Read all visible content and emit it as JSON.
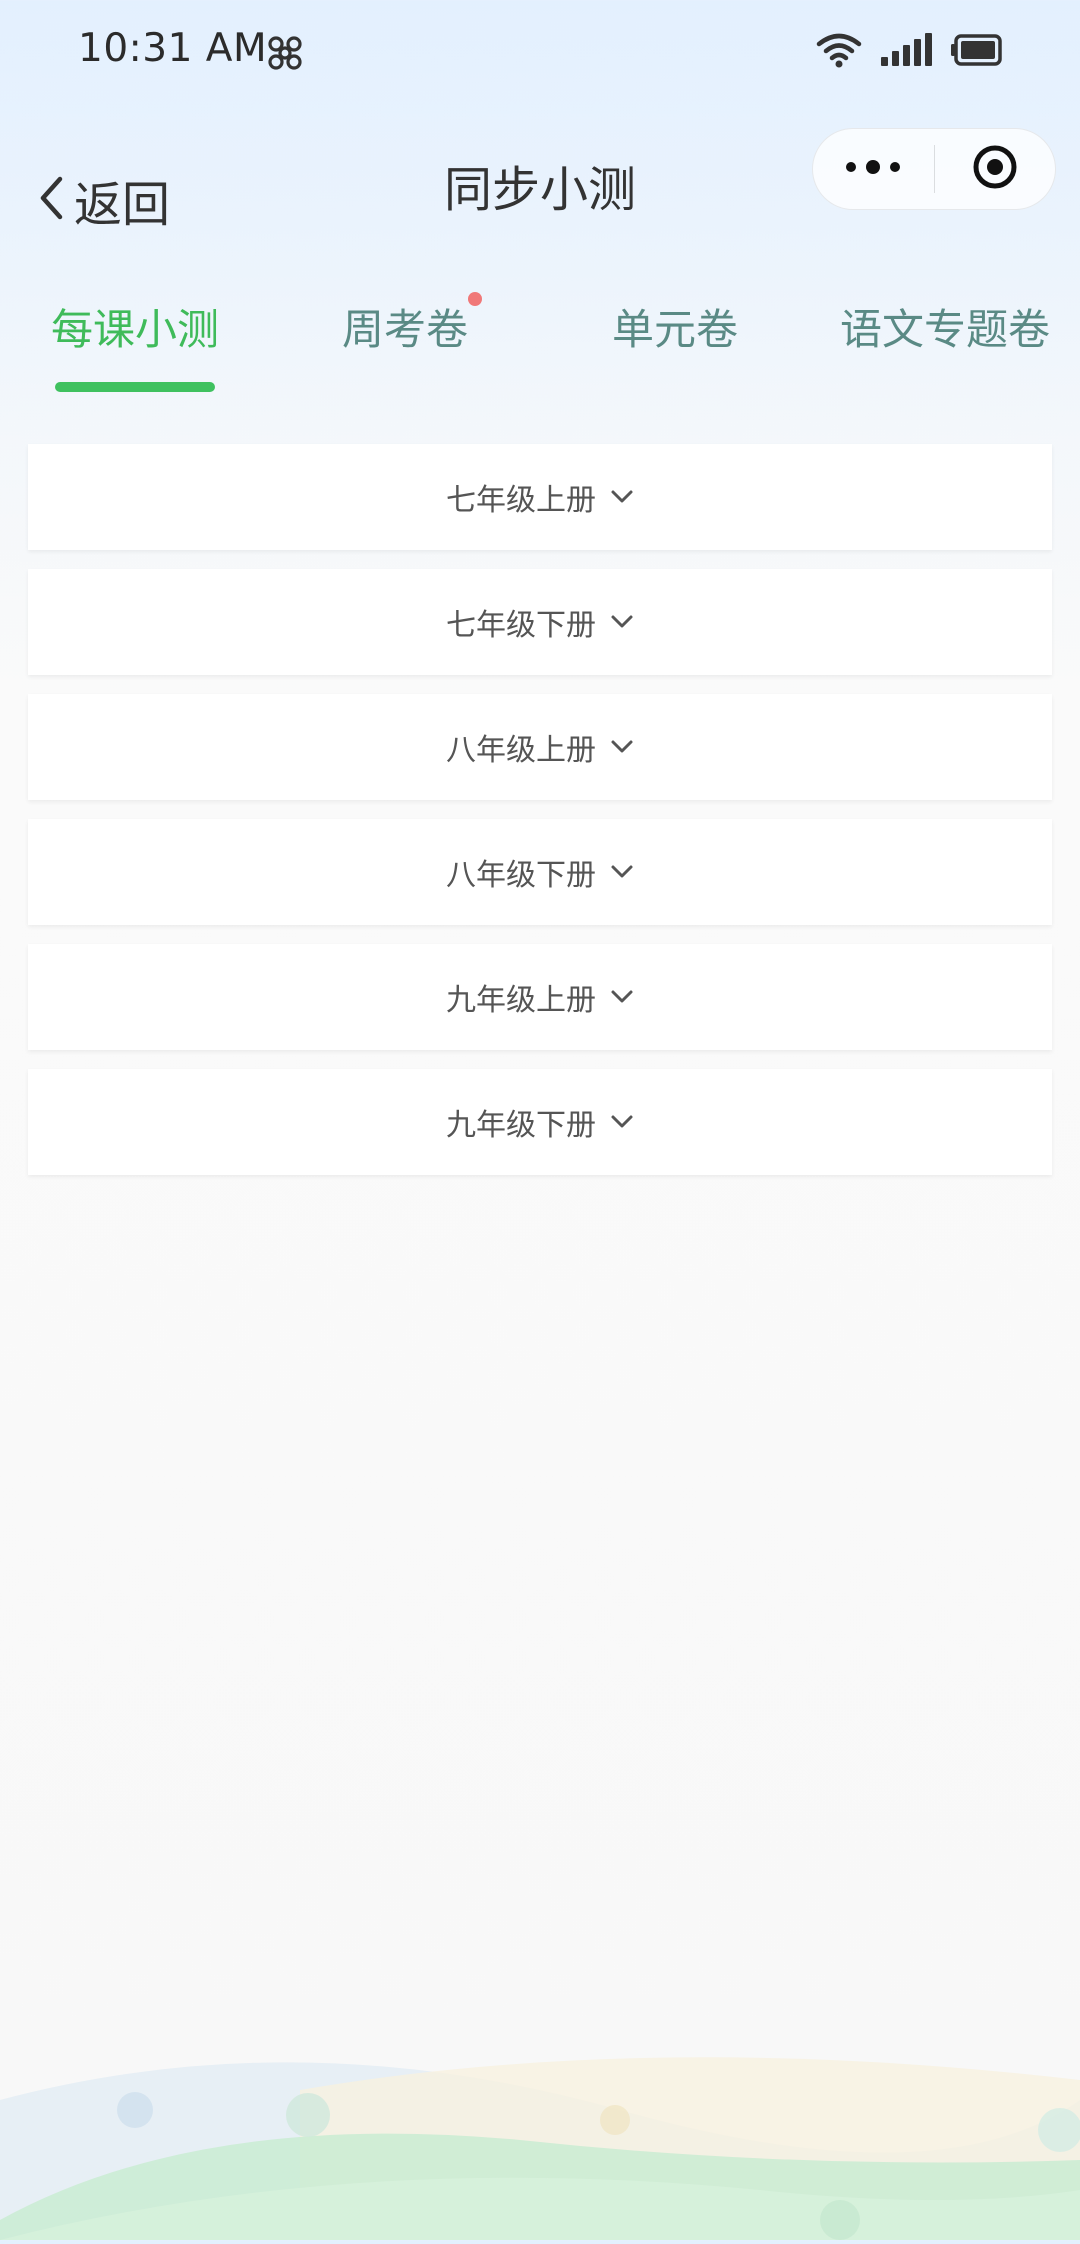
{
  "status_bar": {
    "time": "10:31 AM",
    "icons": [
      "china-unicom-logo-icon",
      "wifi-icon",
      "cellular-signal-icon",
      "battery-icon"
    ]
  },
  "nav": {
    "back_label": "返回",
    "title": "同步小测",
    "capsule_icons": [
      "more-dots-icon",
      "close-target-icon"
    ]
  },
  "tabs": [
    {
      "label": "每课小测",
      "active": true,
      "badge": false
    },
    {
      "label": "周考卷",
      "active": false,
      "badge": true
    },
    {
      "label": "单元卷",
      "active": false,
      "badge": false
    },
    {
      "label": "语文专题卷",
      "active": false,
      "badge": false
    }
  ],
  "grades": [
    {
      "label": "七年级上册"
    },
    {
      "label": "七年级下册"
    },
    {
      "label": "八年级上册"
    },
    {
      "label": "八年级下册"
    },
    {
      "label": "九年级上册"
    },
    {
      "label": "九年级下册"
    }
  ],
  "colors": {
    "accent_green": "#3fbb5a",
    "tab_inactive": "#5a8a85",
    "badge_red": "#f07878"
  }
}
